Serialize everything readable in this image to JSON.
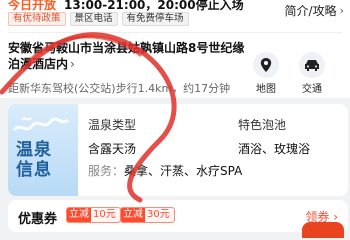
{
  "header": {
    "open_status": "今日开放",
    "hours": "13:00-21:00，20:00停止入场",
    "tags": [
      "有优待政策",
      "景区电话",
      "有免费停车场"
    ],
    "intro_link": "简介/攻略"
  },
  "location": {
    "address": "安徽省马鞍山市当涂县姑孰镇山路8号世纪缘泊漫酒店内",
    "route": "距新华东驾校(公交站)步行1.4km，约17分钟",
    "nav": [
      {
        "label": "地图",
        "icon": "map-pin-icon"
      },
      {
        "label": "交通",
        "icon": "car-icon"
      }
    ]
  },
  "spring": {
    "title": "温泉信息",
    "type_label": "温泉类型",
    "type_value": "含露天汤",
    "pools_label": "特色泡池",
    "pools_value": "酒浴、玫瑰浴",
    "services_label": "服务：",
    "services_value": "桑拿、汗蒸、水疗SPA"
  },
  "coupons": {
    "label": "优惠券",
    "items": [
      {
        "pre": "立减",
        "amount": "10元"
      },
      {
        "pre": "立减",
        "amount": "30元"
      }
    ],
    "claim": "领券 ›"
  },
  "colors": {
    "accent": "#ff4a2e",
    "spring_blue": "#1f5f9c"
  }
}
